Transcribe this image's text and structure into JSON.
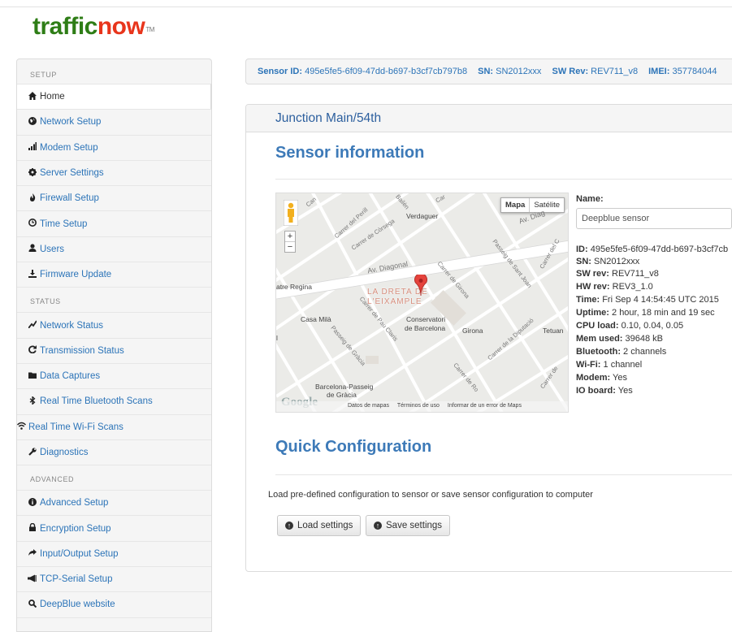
{
  "brand": {
    "part1": "traffic",
    "part2": "now",
    "tm": "TM"
  },
  "sidebar": {
    "sections": {
      "setup": "SETUP",
      "status": "STATUS",
      "advanced": "ADVANCED"
    },
    "setup_items": [
      {
        "label": "Home",
        "icon": "home-icon"
      },
      {
        "label": "Network Setup",
        "icon": "globe-icon"
      },
      {
        "label": "Modem Setup",
        "icon": "signal-icon"
      },
      {
        "label": "Server Settings",
        "icon": "gear-icon"
      },
      {
        "label": "Firewall Setup",
        "icon": "fire-icon"
      },
      {
        "label": "Time Setup",
        "icon": "clock-icon"
      },
      {
        "label": "Users",
        "icon": "user-icon"
      },
      {
        "label": "Firmware Update",
        "icon": "download-icon"
      }
    ],
    "status_items": [
      {
        "label": "Network Status",
        "icon": "pulse-icon"
      },
      {
        "label": "Transmission Status",
        "icon": "refresh-icon"
      },
      {
        "label": "Data Captures",
        "icon": "folder-icon"
      },
      {
        "label": "Real Time Bluetooth Scans",
        "icon": "bluetooth-icon"
      },
      {
        "label": "Real Time Wi-Fi Scans",
        "icon": "wifi-icon"
      },
      {
        "label": "Diagnostics",
        "icon": "wrench-icon"
      }
    ],
    "advanced_items": [
      {
        "label": "Advanced Setup",
        "icon": "info-icon"
      },
      {
        "label": "Encryption Setup",
        "icon": "lock-icon"
      },
      {
        "label": "Input/Output Setup",
        "icon": "share-icon"
      },
      {
        "label": "TCP-Serial Setup",
        "icon": "bullhorn-icon"
      },
      {
        "label": "DeepBlue website",
        "icon": "search-icon"
      }
    ]
  },
  "infobar": {
    "sensor_id_label": "Sensor ID:",
    "sensor_id": "495e5fe5-6f09-47dd-b697-b3cf7cb797b8",
    "sn_label": "SN:",
    "sn": "SN2012xxx",
    "sw_label": "SW Rev:",
    "sw": "REV711_v8",
    "imei_label": "IMEI:",
    "imei": "357784044"
  },
  "panel": {
    "title": "Junction Main/54th",
    "sensor_info_heading": "Sensor information",
    "quick_config_heading": "Quick Configuration",
    "quick_config_desc": "Load pre-defined configuration to sensor or save sensor configuration to computer",
    "load_button": "Load settings",
    "save_button": "Save settings"
  },
  "map": {
    "type_map": "Mapa",
    "type_satellite": "Satélite",
    "zoom_in": "+",
    "zoom_out": "−",
    "labels": {
      "can": "Can",
      "perill": "Carrer del Perill",
      "corsega": "Carrer de Còrsega",
      "bailen": "Bailèn",
      "verdaguer": "Verdaguer",
      "avdiag": "Av. Diag",
      "diagonal": "Av. Diagonal",
      "regina": "atre Regina",
      "dreta1": "LA DRETA DE",
      "dreta2": "L'EIXAMPLE",
      "girona_st": "Carrer de Girona",
      "santjoan": "Passeig de Sant Joan",
      "carrerdelc": "Carrer del C",
      "casamila": "Casa Milà",
      "pauclaris": "Carrer de Pau Claris",
      "conserv1": "Conservatori",
      "conserv2": "de Barcelona",
      "girona": "Girona",
      "diputacio": "Carrer de la Diputació",
      "tetuan": "Tetuan",
      "passeig_gracia": "Passeig de Gràcia",
      "bcnpg1": "Barcelona-Passeig",
      "bcnpg2": "de Gràcia",
      "roger": "Carrer de Ro",
      "carrerde": "Carrer de",
      "l": "l",
      "car": "Car"
    },
    "footer": {
      "data": "Datos de mapas",
      "terms": "Términos de uso",
      "report": "Informar de un error de Maps"
    },
    "google": "Google"
  },
  "sensor": {
    "name_label": "Name:",
    "name_value": "Deepblue sensor",
    "id_label": "ID:",
    "id": "495e5fe5-6f09-47dd-b697-b3cf7cb",
    "sn_label": "SN:",
    "sn": "SN2012xxx",
    "swrev_label": "SW rev:",
    "swrev": "REV711_v8",
    "hwrev_label": "HW rev:",
    "hwrev": "REV3_1.0",
    "time_label": "Time:",
    "time": "Fri Sep 4 14:54:45 UTC 2015",
    "uptime_label": "Uptime:",
    "uptime": "2 hour, 18 min and 19 sec",
    "cpu_label": "CPU load:",
    "cpu": "0.10, 0.04, 0.05",
    "mem_label": "Mem used:",
    "mem": "39648 kB",
    "bt_label": "Bluetooth:",
    "bt": "2 channels",
    "wifi_label": "Wi-Fi:",
    "wifi": "1 channel",
    "modem_label": "Modem:",
    "modem": "Yes",
    "io_label": "IO board:",
    "io": "Yes"
  }
}
